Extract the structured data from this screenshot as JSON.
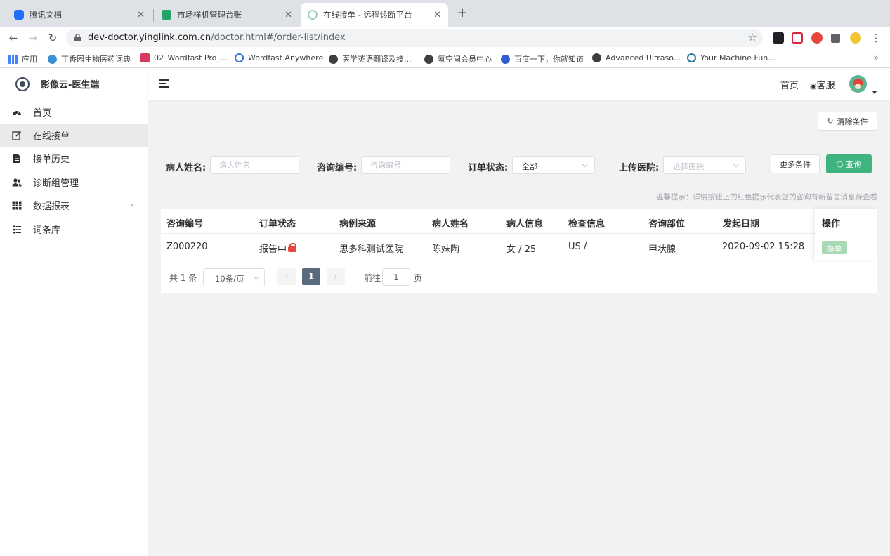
{
  "browser": {
    "tabs": [
      {
        "title": "腾讯文档",
        "icon": "tencent-docs-icon",
        "active": false
      },
      {
        "title": "市场样机管理台账",
        "icon": "sheet-icon",
        "active": false
      },
      {
        "title": "在线接单 - 远程诊断平台",
        "icon": "site-icon",
        "active": true
      }
    ],
    "url_host": "dev-doctor.yinglink.com.cn",
    "url_rest": "/doctor.html#/order-list/index",
    "bookmarks": [
      {
        "label": "应用",
        "icon": "apps-grid-icon"
      },
      {
        "label": "丁香园生物医药词典",
        "icon": "dxy-icon"
      },
      {
        "label": "02_Wordfast Pro_...",
        "icon": "wordfast-icon"
      },
      {
        "label": "Wordfast Anywhere",
        "icon": "wordfast-anywhere-icon"
      },
      {
        "label": "医学英语翻译及技...",
        "icon": "globe-icon"
      },
      {
        "label": "氪空间会员中心",
        "icon": "globe-icon"
      },
      {
        "label": "百度一下，你就知道",
        "icon": "baidu-icon"
      },
      {
        "label": "Advanced Ultraso...",
        "icon": "globe-icon"
      },
      {
        "label": "Your Machine Fun...",
        "icon": "wordpress-icon"
      }
    ],
    "more_label": "»"
  },
  "app": {
    "logo_text": "影像云-医生端",
    "menu": [
      {
        "label": "首页",
        "icon": "dashboard-icon"
      },
      {
        "label": "在线接单",
        "icon": "edit-icon",
        "active": true
      },
      {
        "label": "接单历史",
        "icon": "document-icon"
      },
      {
        "label": "诊断组管理",
        "icon": "users-icon"
      },
      {
        "label": "数据报表",
        "icon": "table-icon",
        "has_children": true
      },
      {
        "label": "词条库",
        "icon": "list-icon"
      }
    ],
    "topbar": {
      "home": "首页",
      "service": "客服",
      "service_icon": "eye-icon"
    }
  },
  "filters": {
    "clear_button": "清除条件",
    "patient_name": {
      "label": "病人姓名:",
      "placeholder": "病人姓名",
      "value": ""
    },
    "consult_no": {
      "label": "咨询编号:",
      "placeholder": "咨询编号",
      "value": ""
    },
    "order_status": {
      "label": "订单状态:",
      "value": "全部"
    },
    "hospital": {
      "label": "上传医院:",
      "placeholder": "选择医院"
    },
    "more_button": "更多条件",
    "search_button": "查询",
    "hint": "温馨提示：详情按钮上的红色提示代表您的咨询有新留言消息待查看"
  },
  "table": {
    "headers": [
      "咨询编号",
      "订单状态",
      "病例来源",
      "病人姓名",
      "病人信息",
      "检查信息",
      "咨询部位",
      "发起日期",
      "操作"
    ],
    "rows": [
      {
        "id": "Z000220",
        "status": "报告中",
        "source": "思多科测试医院",
        "name": "陈妹陶",
        "info": "女 / 25",
        "exam": "US /",
        "part": "甲状腺",
        "date": "2020-09-02 15:28",
        "action": "接单"
      }
    ]
  },
  "pagination": {
    "total": "共 1 条",
    "page_size": "10条/页",
    "prev": "‹",
    "current": "1",
    "next": "›",
    "goto_prefix": "前往",
    "goto_value": "1",
    "goto_suffix": "页"
  },
  "colors": {
    "primary": "#3fb47f",
    "accept_btn": "#a7d9b4",
    "lock": "#e8453c",
    "current_page": "#5a6a7d"
  }
}
